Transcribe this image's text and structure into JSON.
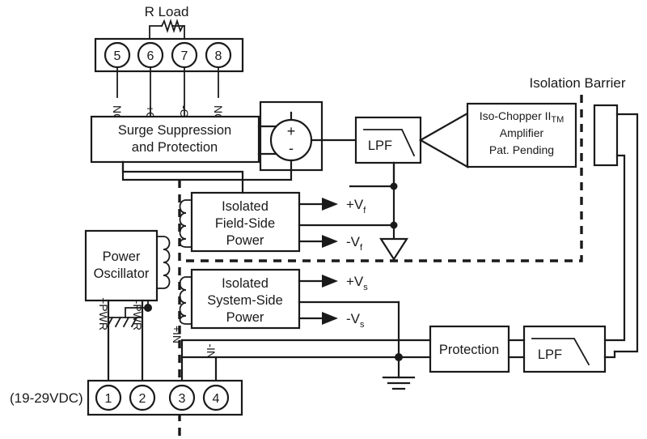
{
  "diagram": {
    "title": "Isolation Barrier",
    "labels": {
      "r_load": "R Load",
      "isolation_barrier": "Isolation Barrier",
      "supply_range": "(19-29VDC)"
    },
    "blocks": {
      "surge": {
        "line1": "Surge Suppression",
        "line2": "and Protection"
      },
      "amplifier": {
        "line1": "Iso-Chopper II",
        "trademark": "TM",
        "line2": "Amplifier",
        "line3": "Pat. Pending"
      },
      "lpf_top": "LPF",
      "lpf_bottom": "LPF",
      "protection": "Protection",
      "field_power": {
        "line1": "Isolated",
        "line2": "Field-Side",
        "line3": "Power"
      },
      "system_power": {
        "line1": "Isolated",
        "line2": "System-Side",
        "line3": "Power"
      },
      "oscillator": {
        "line1": "Power",
        "line2": "Oscillator"
      }
    },
    "summing_node": {
      "plus": "+",
      "minus": "-"
    },
    "rails": {
      "field_pos": "+V",
      "field_pos_sub": "f",
      "field_neg": "-V",
      "field_neg_sub": "f",
      "system_pos": "+V",
      "system_pos_sub": "s",
      "system_neg": "-V",
      "system_neg_sub": "s"
    },
    "top_terminals": [
      {
        "number": "5",
        "label": "NC"
      },
      {
        "number": "6",
        "label": "+OUT"
      },
      {
        "number": "7",
        "label": "-OUT"
      },
      {
        "number": "8",
        "label": "NC"
      }
    ],
    "bottom_terminals": [
      {
        "number": "1",
        "label": "+PWR"
      },
      {
        "number": "2",
        "label": "-PWR"
      },
      {
        "number": "3",
        "label": "+IN"
      },
      {
        "number": "4",
        "label": "-IN"
      }
    ],
    "colors": {
      "line": "#1a1a1a",
      "background": "#ffffff"
    }
  }
}
